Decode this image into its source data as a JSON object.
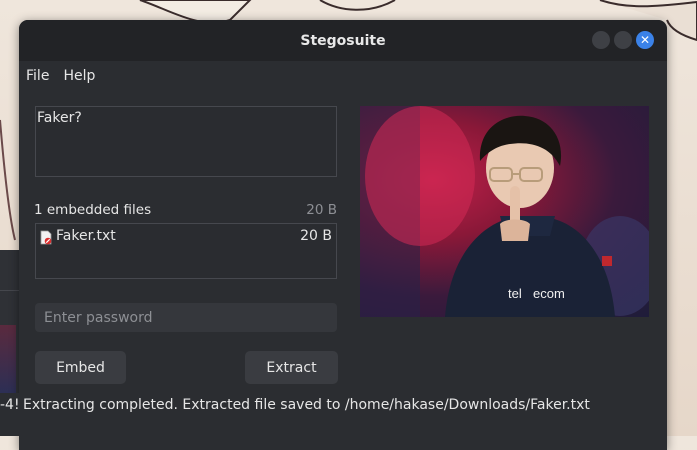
{
  "window": {
    "title": "Stegosuite"
  },
  "menu": {
    "file": "File",
    "help": "Help"
  },
  "message": {
    "text": "Faker?"
  },
  "embedded": {
    "header": "1 embedded files",
    "total_size": "20 B",
    "files": [
      {
        "name": "Faker.txt",
        "size": "20 B",
        "icon": "text-file-icon"
      }
    ]
  },
  "password": {
    "value": "",
    "placeholder": "Enter password"
  },
  "buttons": {
    "embed": "Embed",
    "extract": "Extract"
  },
  "status": {
    "prefix": "-4!",
    "message": "Extracting completed. Extracted file saved to /home/hakase/Downloads/Faker.txt"
  },
  "colors": {
    "accent": "#3b82e8",
    "window_bg": "#2b2d31",
    "titlebar_bg": "#222326"
  }
}
